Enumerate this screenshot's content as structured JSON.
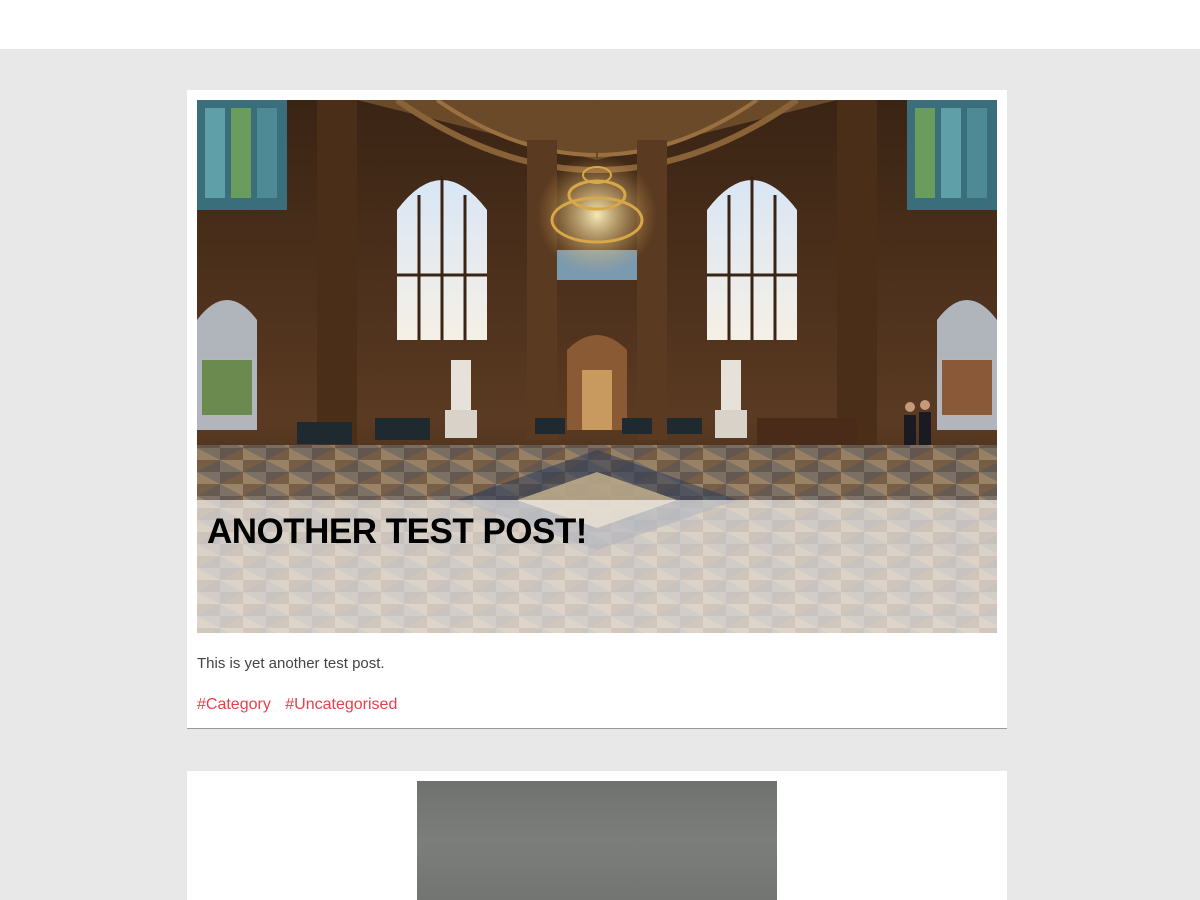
{
  "posts": [
    {
      "title": "ANOTHER TEST POST!",
      "excerpt": "This is yet another test post.",
      "tags": [
        "#Category",
        "#Uncategorised"
      ]
    }
  ],
  "colors": {
    "page_background": "#e8e8e8",
    "tag_link": "#e8404a",
    "title": "#000000"
  }
}
